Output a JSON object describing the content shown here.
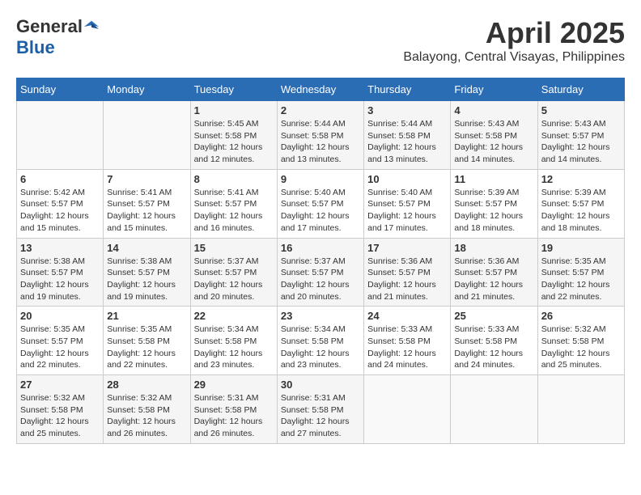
{
  "header": {
    "logo_general": "General",
    "logo_blue": "Blue",
    "month_title": "April 2025",
    "location": "Balayong, Central Visayas, Philippines"
  },
  "days_of_week": [
    "Sunday",
    "Monday",
    "Tuesday",
    "Wednesday",
    "Thursday",
    "Friday",
    "Saturday"
  ],
  "weeks": [
    [
      {
        "day": "",
        "info": ""
      },
      {
        "day": "",
        "info": ""
      },
      {
        "day": "1",
        "info": "Sunrise: 5:45 AM\nSunset: 5:58 PM\nDaylight: 12 hours and 12 minutes."
      },
      {
        "day": "2",
        "info": "Sunrise: 5:44 AM\nSunset: 5:58 PM\nDaylight: 12 hours and 13 minutes."
      },
      {
        "day": "3",
        "info": "Sunrise: 5:44 AM\nSunset: 5:58 PM\nDaylight: 12 hours and 13 minutes."
      },
      {
        "day": "4",
        "info": "Sunrise: 5:43 AM\nSunset: 5:58 PM\nDaylight: 12 hours and 14 minutes."
      },
      {
        "day": "5",
        "info": "Sunrise: 5:43 AM\nSunset: 5:57 PM\nDaylight: 12 hours and 14 minutes."
      }
    ],
    [
      {
        "day": "6",
        "info": "Sunrise: 5:42 AM\nSunset: 5:57 PM\nDaylight: 12 hours and 15 minutes."
      },
      {
        "day": "7",
        "info": "Sunrise: 5:41 AM\nSunset: 5:57 PM\nDaylight: 12 hours and 15 minutes."
      },
      {
        "day": "8",
        "info": "Sunrise: 5:41 AM\nSunset: 5:57 PM\nDaylight: 12 hours and 16 minutes."
      },
      {
        "day": "9",
        "info": "Sunrise: 5:40 AM\nSunset: 5:57 PM\nDaylight: 12 hours and 17 minutes."
      },
      {
        "day": "10",
        "info": "Sunrise: 5:40 AM\nSunset: 5:57 PM\nDaylight: 12 hours and 17 minutes."
      },
      {
        "day": "11",
        "info": "Sunrise: 5:39 AM\nSunset: 5:57 PM\nDaylight: 12 hours and 18 minutes."
      },
      {
        "day": "12",
        "info": "Sunrise: 5:39 AM\nSunset: 5:57 PM\nDaylight: 12 hours and 18 minutes."
      }
    ],
    [
      {
        "day": "13",
        "info": "Sunrise: 5:38 AM\nSunset: 5:57 PM\nDaylight: 12 hours and 19 minutes."
      },
      {
        "day": "14",
        "info": "Sunrise: 5:38 AM\nSunset: 5:57 PM\nDaylight: 12 hours and 19 minutes."
      },
      {
        "day": "15",
        "info": "Sunrise: 5:37 AM\nSunset: 5:57 PM\nDaylight: 12 hours and 20 minutes."
      },
      {
        "day": "16",
        "info": "Sunrise: 5:37 AM\nSunset: 5:57 PM\nDaylight: 12 hours and 20 minutes."
      },
      {
        "day": "17",
        "info": "Sunrise: 5:36 AM\nSunset: 5:57 PM\nDaylight: 12 hours and 21 minutes."
      },
      {
        "day": "18",
        "info": "Sunrise: 5:36 AM\nSunset: 5:57 PM\nDaylight: 12 hours and 21 minutes."
      },
      {
        "day": "19",
        "info": "Sunrise: 5:35 AM\nSunset: 5:57 PM\nDaylight: 12 hours and 22 minutes."
      }
    ],
    [
      {
        "day": "20",
        "info": "Sunrise: 5:35 AM\nSunset: 5:57 PM\nDaylight: 12 hours and 22 minutes."
      },
      {
        "day": "21",
        "info": "Sunrise: 5:35 AM\nSunset: 5:58 PM\nDaylight: 12 hours and 22 minutes."
      },
      {
        "day": "22",
        "info": "Sunrise: 5:34 AM\nSunset: 5:58 PM\nDaylight: 12 hours and 23 minutes."
      },
      {
        "day": "23",
        "info": "Sunrise: 5:34 AM\nSunset: 5:58 PM\nDaylight: 12 hours and 23 minutes."
      },
      {
        "day": "24",
        "info": "Sunrise: 5:33 AM\nSunset: 5:58 PM\nDaylight: 12 hours and 24 minutes."
      },
      {
        "day": "25",
        "info": "Sunrise: 5:33 AM\nSunset: 5:58 PM\nDaylight: 12 hours and 24 minutes."
      },
      {
        "day": "26",
        "info": "Sunrise: 5:32 AM\nSunset: 5:58 PM\nDaylight: 12 hours and 25 minutes."
      }
    ],
    [
      {
        "day": "27",
        "info": "Sunrise: 5:32 AM\nSunset: 5:58 PM\nDaylight: 12 hours and 25 minutes."
      },
      {
        "day": "28",
        "info": "Sunrise: 5:32 AM\nSunset: 5:58 PM\nDaylight: 12 hours and 26 minutes."
      },
      {
        "day": "29",
        "info": "Sunrise: 5:31 AM\nSunset: 5:58 PM\nDaylight: 12 hours and 26 minutes."
      },
      {
        "day": "30",
        "info": "Sunrise: 5:31 AM\nSunset: 5:58 PM\nDaylight: 12 hours and 27 minutes."
      },
      {
        "day": "",
        "info": ""
      },
      {
        "day": "",
        "info": ""
      },
      {
        "day": "",
        "info": ""
      }
    ]
  ]
}
